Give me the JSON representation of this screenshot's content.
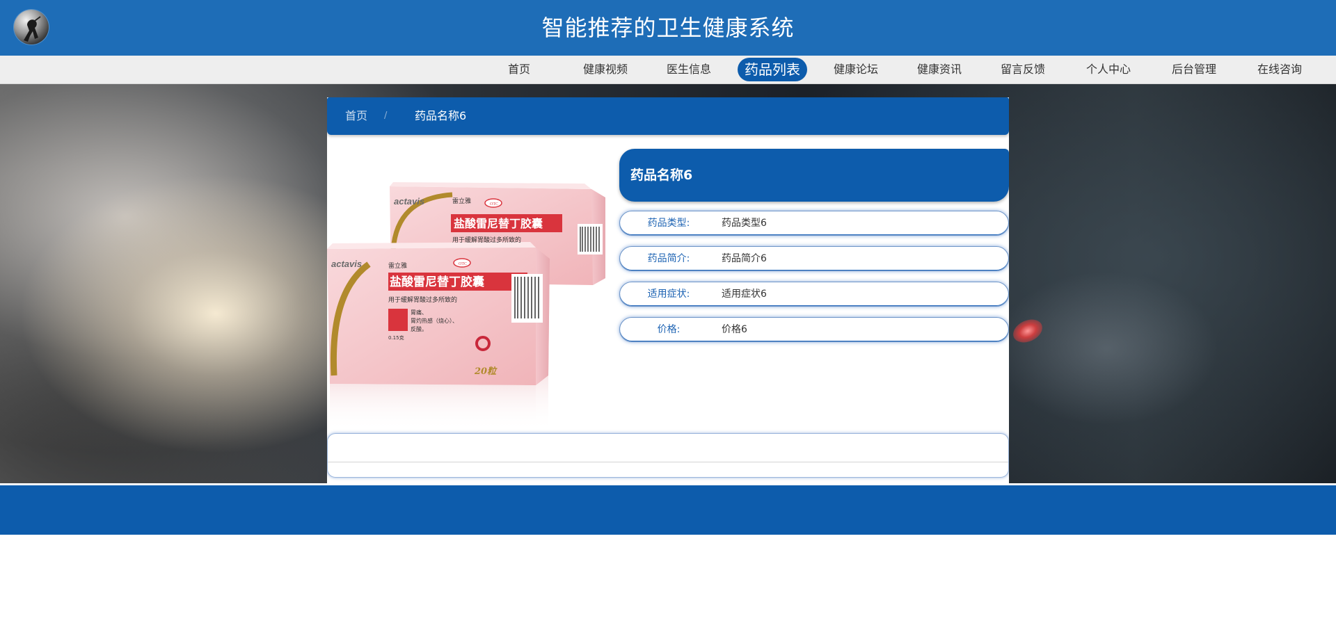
{
  "header": {
    "title": "智能推荐的卫生健康系统",
    "logo_icon": "user-silhouette-logo-icon"
  },
  "nav": {
    "items": [
      {
        "label": "首页",
        "active": false
      },
      {
        "label": "健康视频",
        "active": false
      },
      {
        "label": "医生信息",
        "active": false
      },
      {
        "label": "药品列表",
        "active": true
      },
      {
        "label": "健康论坛",
        "active": false
      },
      {
        "label": "健康资讯",
        "active": false
      },
      {
        "label": "留言反馈",
        "active": false
      },
      {
        "label": "个人中心",
        "active": false
      },
      {
        "label": "后台管理",
        "active": false
      },
      {
        "label": "在线咨询",
        "active": false
      }
    ]
  },
  "breadcrumb": {
    "home": "首页",
    "separator": "/",
    "current": "药品名称6"
  },
  "product": {
    "name": "药品名称6",
    "image": {
      "brand": "actavis",
      "brand_cn": "雷立雅",
      "box_title": "盐酸雷尼替丁胶囊",
      "usage": "用于缓解胃酸过多所致的",
      "symptoms": "胃痛、",
      "symptoms2": "胃灼热感（烧心）、",
      "symptoms3": "反酸。",
      "dose": "0.15克",
      "count": "20粒",
      "otc": "OTC"
    },
    "fields": [
      {
        "label": "药品类型:",
        "value": "药品类型6"
      },
      {
        "label": "药品简介:",
        "value": "药品简介6"
      },
      {
        "label": "适用症状:",
        "value": "适用症状6"
      },
      {
        "label": "价格:",
        "value": "价格6"
      }
    ]
  },
  "colors": {
    "header_bg": "#1e6db7",
    "primary": "#0d5cac",
    "nav_bg": "#eeeeee",
    "label_text": "#1d63b3"
  }
}
